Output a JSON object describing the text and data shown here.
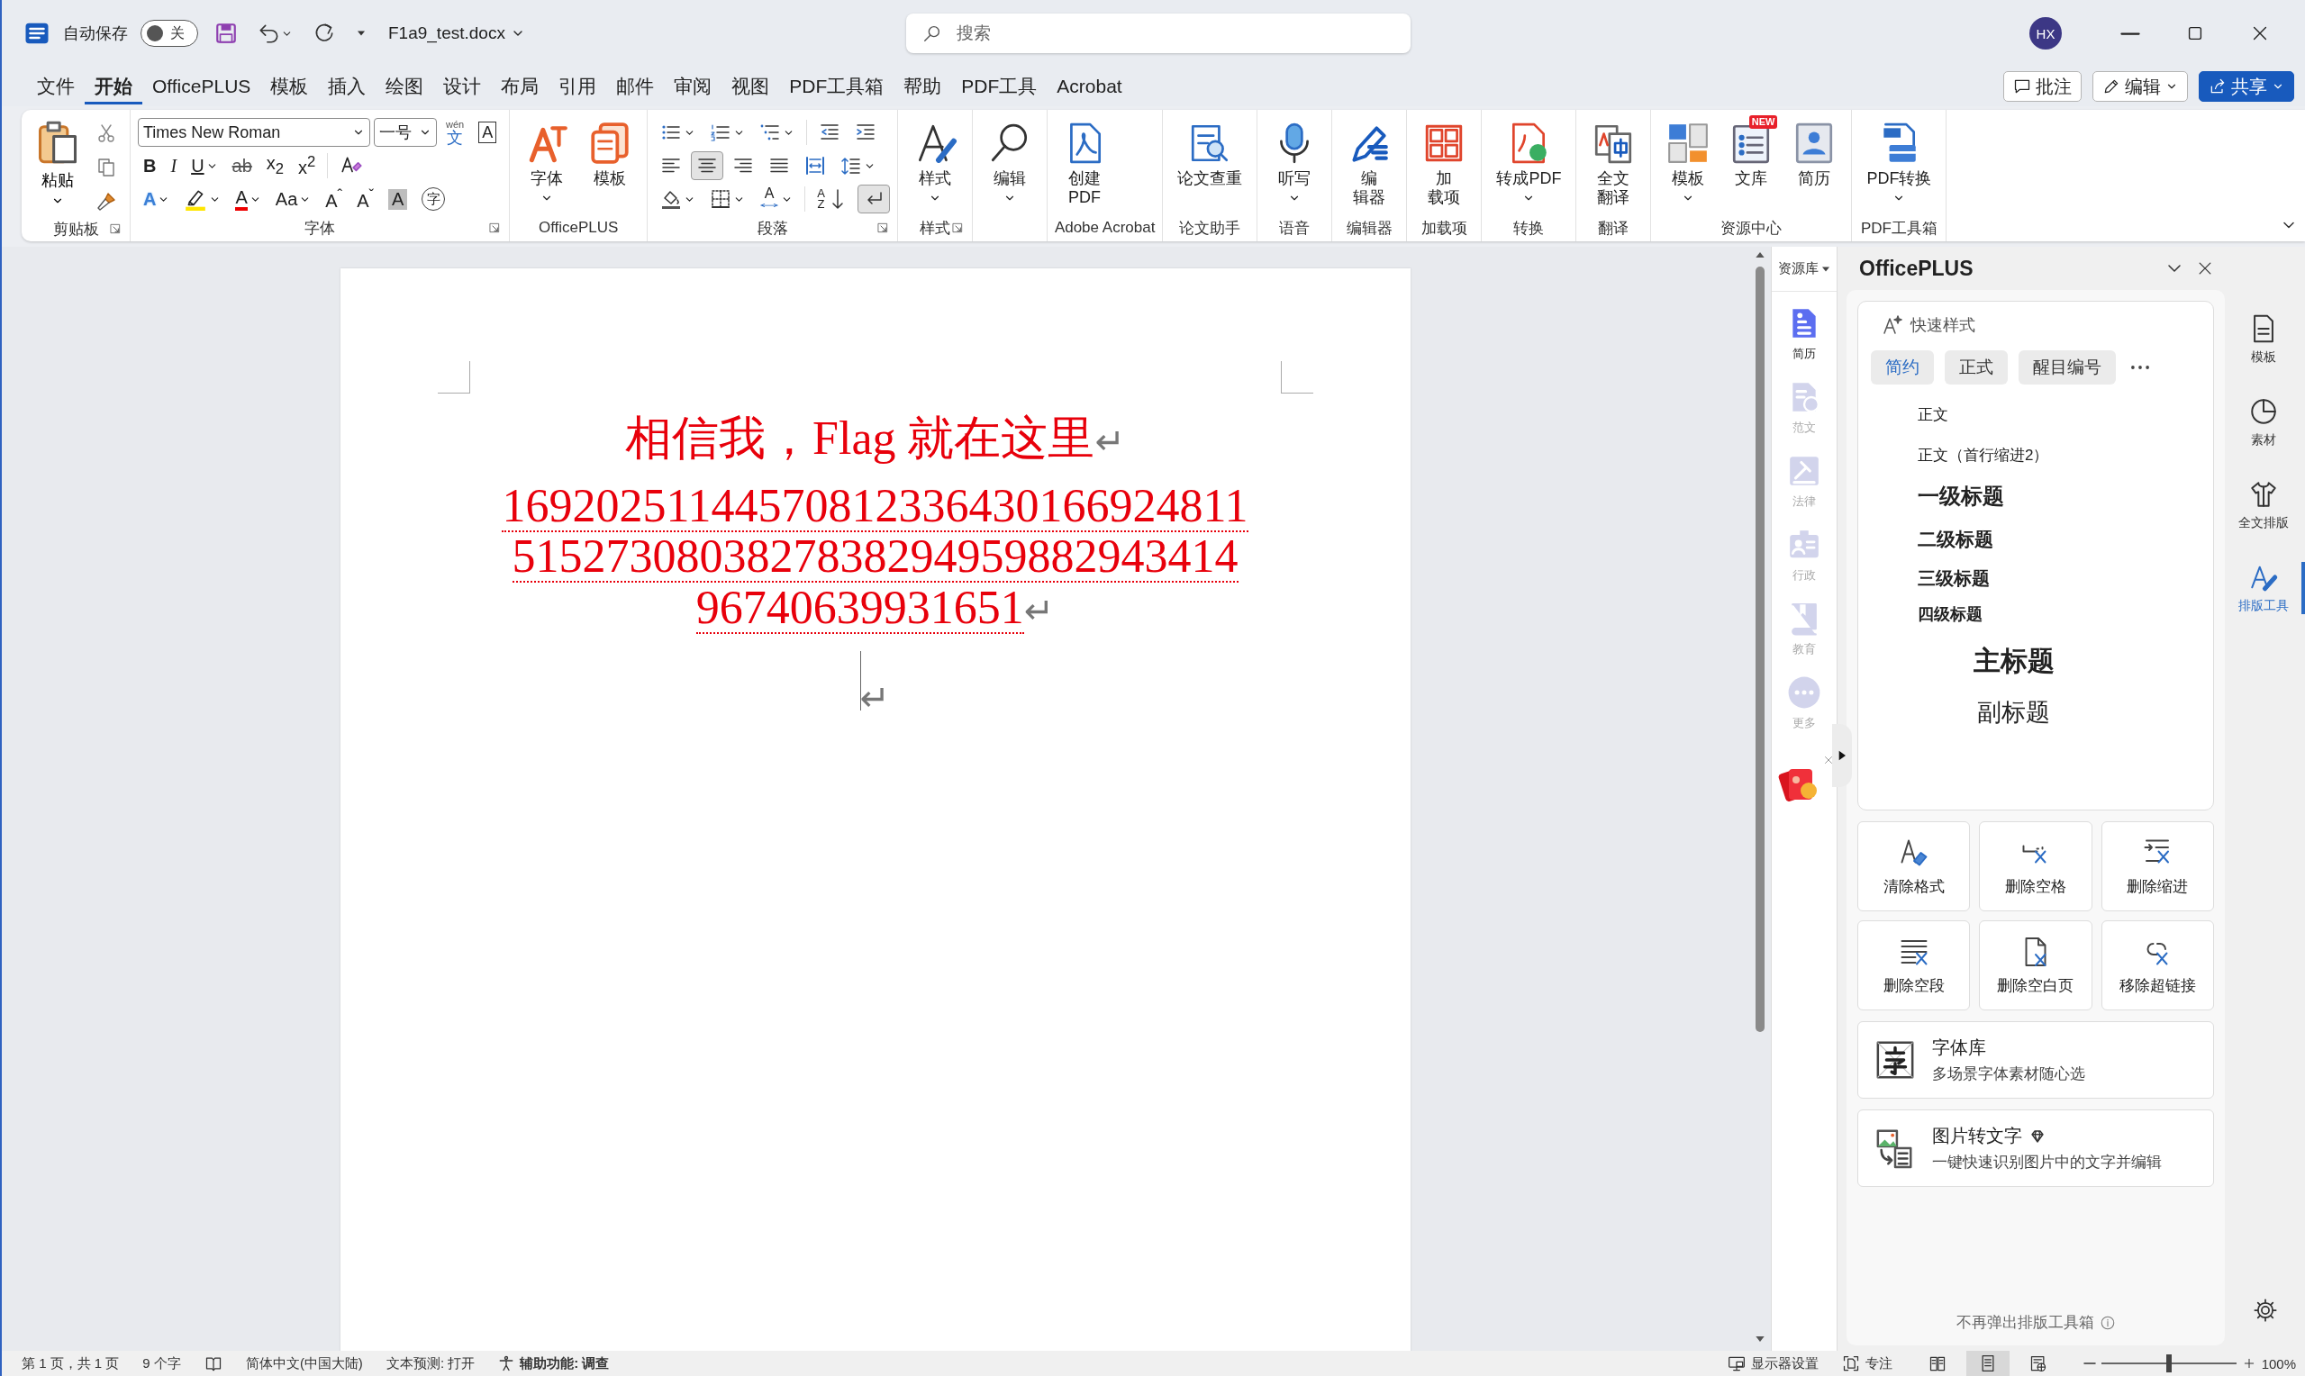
{
  "title_bar": {
    "autosave_label": "自动保存",
    "autosave": {
      "on": false,
      "label": "关"
    },
    "file_name": "F1a9_test.docx",
    "search": {
      "placeholder": "搜索"
    },
    "avatar": "HX"
  },
  "menu_tabs": [
    {
      "label": "文件",
      "selected": false
    },
    {
      "label": "开始",
      "selected": true
    },
    {
      "label": "OfficePLUS",
      "selected": false
    },
    {
      "label": "模板",
      "selected": false
    },
    {
      "label": "插入",
      "selected": false
    },
    {
      "label": "绘图",
      "selected": false
    },
    {
      "label": "设计",
      "selected": false
    },
    {
      "label": "布局",
      "selected": false
    },
    {
      "label": "引用",
      "selected": false
    },
    {
      "label": "邮件",
      "selected": false
    },
    {
      "label": "审阅",
      "selected": false
    },
    {
      "label": "视图",
      "selected": false
    },
    {
      "label": "PDF工具箱",
      "selected": false
    },
    {
      "label": "帮助",
      "selected": false
    },
    {
      "label": "PDF工具",
      "selected": false
    },
    {
      "label": "Acrobat",
      "selected": false
    }
  ],
  "menu_actions": [
    {
      "label": "批注",
      "kind": "plain"
    },
    {
      "label": "编辑",
      "kind": "dropdown"
    },
    {
      "label": "共享",
      "kind": "primary"
    }
  ],
  "ribbon": {
    "groups": [
      {
        "kind": "clipboard",
        "label": "剪贴板",
        "launcher": true,
        "paste": "粘贴"
      },
      {
        "kind": "font",
        "label": "字体",
        "launcher": true,
        "font_name": "Times New Roman",
        "font_size": "一号",
        "phonetic": {
          "ruby": "wén",
          "glyph": "文"
        },
        "border_glyph": "A",
        "format": [
          {
            "glyph": "B"
          },
          {
            "glyph": "I"
          },
          {
            "glyph": "U",
            "dropdown": true
          },
          {
            "glyph": "ab"
          },
          {
            "glyph": "x$_{2}$"
          },
          {
            "glyph": "x$^{2}$"
          }
        ],
        "effects": [
          {
            "kind": "glyph",
            "glyph": "A",
            "dropdown": true
          },
          {
            "kind": "highlight",
            "dropdown": true
          },
          {
            "kind": "glyph",
            "glyph": "A",
            "dropdown": true
          },
          {
            "kind": "glyph",
            "glyph": "Aa",
            "dropdown": true
          },
          {
            "kind": "glyph",
            "glyph": "A$^{ˆ}$"
          },
          {
            "kind": "glyph",
            "glyph": "A$^{ˇ}$"
          },
          {
            "kind": "glyph",
            "glyph": "A"
          },
          {
            "kind": "glyph",
            "glyph": "字"
          }
        ]
      },
      {
        "kind": "buttons",
        "label": "OfficePLUS",
        "buttons": [
          {
            "label": "字体",
            "dropdown": true
          },
          {
            "label": "模板"
          }
        ]
      },
      {
        "kind": "paragraph",
        "label": "段落",
        "launcher": true,
        "rows": [
          [
            {
              "selected": false,
              "dropdown": true
            },
            {
              "selected": false,
              "dropdown": true
            },
            {
              "selected": false,
              "dropdown": true
            },
            {
              "selected": false
            },
            {
              "selected": false
            }
          ],
          [
            {
              "selected": false
            },
            {
              "selected": true
            },
            {
              "selected": false
            },
            {
              "selected": false
            },
            {
              "selected": false
            },
            {
              "selected": false,
              "dropdown": true
            }
          ],
          [
            {
              "selected": false,
              "dropdown": true
            },
            {
              "selected": false,
              "dropdown": true
            },
            {
              "selected": false,
              "dropdown": true,
              "glyph": "A"
            },
            {
              "selected": false,
              "glyphs": [
                "A",
                "Z"
              ]
            },
            {
              "selected": true
            }
          ]
        ]
      },
      {
        "kind": "buttons",
        "label": "样式",
        "launcher": true,
        "buttons": [
          {
            "label": "样式",
            "dropdown": true
          }
        ]
      },
      {
        "kind": "buttons",
        "buttons": [
          {
            "label": "编辑",
            "dropdown": true
          }
        ]
      },
      {
        "kind": "buttons",
        "label": "Adobe Acrobat",
        "buttons": [
          {
            "label": "创建\nPDF"
          }
        ]
      },
      {
        "kind": "buttons",
        "label": "论文助手",
        "buttons": [
          {
            "label": "论文查重"
          }
        ]
      },
      {
        "kind": "buttons",
        "label": "语音",
        "buttons": [
          {
            "label": "听写",
            "dropdown": true
          }
        ]
      },
      {
        "kind": "buttons",
        "label": "编辑器",
        "buttons": [
          {
            "label": "编辑器"
          }
        ]
      },
      {
        "kind": "buttons",
        "label": "加载项",
        "buttons": [
          {
            "label": "加载项"
          }
        ]
      },
      {
        "kind": "buttons",
        "label": "转换",
        "buttons": [
          {
            "label": "转成PDF",
            "dropdown": true
          }
        ]
      },
      {
        "kind": "buttons",
        "label": "翻译",
        "buttons": [
          {
            "label": "全文翻译"
          }
        ]
      },
      {
        "kind": "buttons",
        "label": "资源中心",
        "buttons": [
          {
            "label": "模板",
            "dropdown": true
          },
          {
            "label": "文库",
            "badge": "NEW"
          },
          {
            "label": "简历"
          }
        ]
      },
      {
        "kind": "buttons",
        "label": "PDF工具箱",
        "buttons": [
          {
            "label": "PDF转换",
            "dropdown": true
          }
        ]
      }
    ]
  },
  "document": {
    "paragraphs": [
      {
        "lines": [
          "相信我，Flag 就在这里"
        ],
        "mark": "↵"
      },
      {
        "lines": [
          "16920251144570812336430166924811",
          "5152730803827838294959882943414",
          "96740639931651"
        ],
        "mark": "↵",
        "spelling": true
      },
      {
        "mark": "↵",
        "caret": true
      }
    ]
  },
  "resource_sidebar": {
    "header": "资源库",
    "items": [
      {
        "label": "简历",
        "selected": true
      },
      {
        "label": "范文",
        "selected": false
      },
      {
        "label": "法律",
        "selected": false
      },
      {
        "label": "行政",
        "selected": false
      },
      {
        "label": "教育",
        "selected": false
      },
      {
        "label": "更多",
        "selected": false
      }
    ]
  },
  "officeplus_panel": {
    "title": "OfficePLUS",
    "quick_styles": {
      "title": "快速样式",
      "tabs": [
        {
          "label": "简约",
          "selected": true
        },
        {
          "label": "正式",
          "selected": false
        },
        {
          "label": "醒目编号",
          "selected": false
        }
      ],
      "styles": [
        {
          "label": "正文",
          "kind": "body"
        },
        {
          "label": "正文（首行缩进2）",
          "kind": "body"
        },
        {
          "label": "一级标题",
          "kind": "h1"
        },
        {
          "label": "二级标题",
          "kind": "h2"
        },
        {
          "label": "三级标题",
          "kind": "h3"
        },
        {
          "label": "四级标题",
          "kind": "h4"
        },
        {
          "label": "主标题",
          "kind": "title"
        },
        {
          "label": "副标题",
          "kind": "subtitle"
        }
      ]
    },
    "tools": [
      "清除格式",
      "删除空格",
      "删除缩进",
      "删除空段",
      "删除空白页",
      "移除超链接"
    ],
    "features": [
      {
        "title": "字体库",
        "description": "多场景字体素材随心选"
      },
      {
        "title": "图片转文字",
        "description": "一键快速识别图片中的文字并编辑",
        "premium": true
      }
    ],
    "footer": "不再弹出排版工具箱"
  },
  "panel_tabs": [
    {
      "label": "模板",
      "selected": false
    },
    {
      "label": "素材",
      "selected": false
    },
    {
      "label": "全文排版",
      "selected": false
    },
    {
      "label": "排版工具",
      "selected": true
    }
  ],
  "status_bar": {
    "left": [
      {
        "kind": "text",
        "label": "第 1 页，共 1 页"
      },
      {
        "kind": "text",
        "label": "9 个字"
      },
      {
        "kind": "proofing"
      },
      {
        "kind": "text",
        "label": "简体中文(中国大陆)"
      },
      {
        "kind": "text",
        "label": "文本预测: 打开"
      },
      {
        "kind": "accessibility",
        "label": "辅助功能: 调查"
      }
    ],
    "display_settings": "显示器设置",
    "focus": "专注",
    "views": [
      {
        "selected": false
      },
      {
        "selected": true
      },
      {
        "selected": false
      }
    ],
    "zoom": {
      "level": 0.5,
      "reading": "100%"
    }
  }
}
